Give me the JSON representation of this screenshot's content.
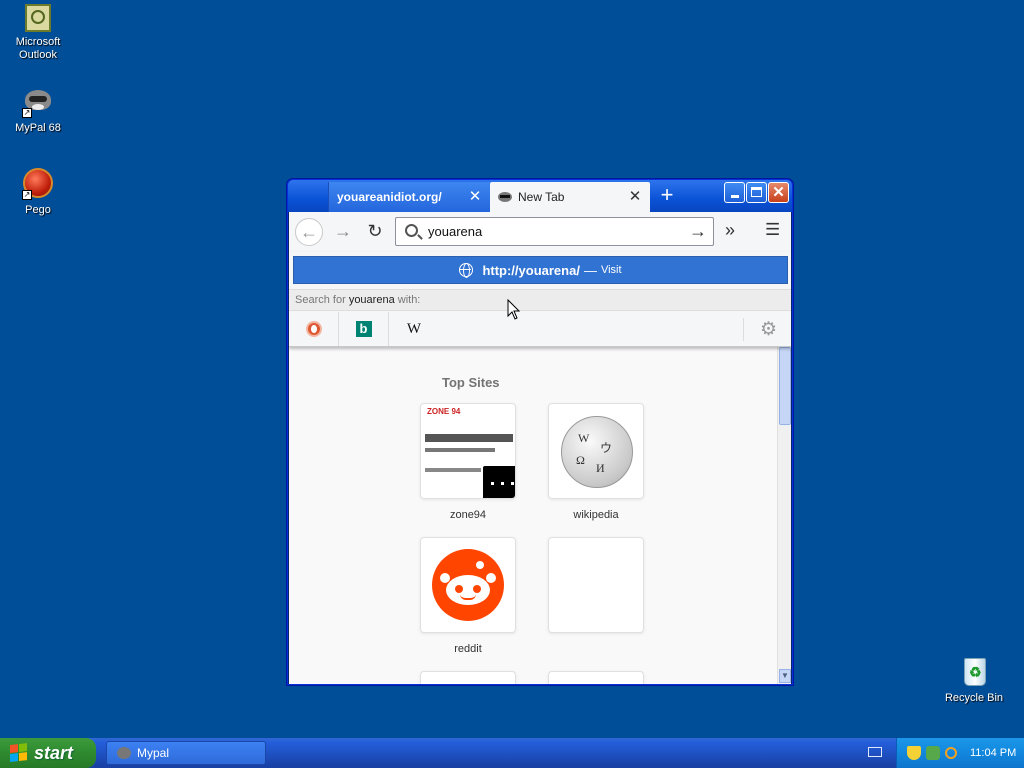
{
  "desktop": {
    "icons": [
      {
        "label": "Microsoft Outlook"
      },
      {
        "label": "MyPal 68"
      },
      {
        "label": "Pego"
      },
      {
        "label": "Recycle Bin"
      }
    ]
  },
  "browser": {
    "tabs": [
      {
        "title": "youareanidiot.org/",
        "active": false
      },
      {
        "title": "New Tab",
        "active": true
      }
    ],
    "url_value": "youarena",
    "dropdown": {
      "suggestion_url": "http://youarena/",
      "suggestion_dash": "—",
      "suggestion_action": "Visit",
      "search_for_prefix": "Search for",
      "search_for_term": "youarena",
      "search_for_suffix": "with:",
      "engines": [
        "duckduckgo",
        "bing",
        "wikipedia"
      ]
    },
    "top_sites": {
      "title": "Top Sites",
      "sites": [
        {
          "name": "zone94"
        },
        {
          "name": "wikipedia"
        },
        {
          "name": "reddit"
        },
        {
          "name": ""
        }
      ]
    }
  },
  "taskbar": {
    "start_label": "start",
    "task_label": "Mypal",
    "clock": "11:04 PM"
  },
  "colors": {
    "desktop": "#004e98",
    "accent": "#3173d2",
    "start_green": "#2f8a2f"
  }
}
